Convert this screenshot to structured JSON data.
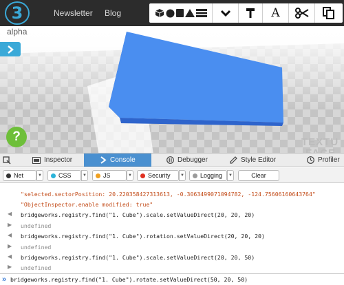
{
  "app": {
    "logo": "3",
    "subtitle": "alpha",
    "nav": [
      "Newsletter",
      "Blog"
    ]
  },
  "toolbar": {
    "shapes_icons": [
      "cube-icon",
      "sphere-icon",
      "cylinder-icon",
      "cone-icon",
      "stack-icon"
    ],
    "tools": [
      "dropdown-icon",
      "hammer-icon",
      "font-icon",
      "scissors-icon",
      "copy-icon"
    ],
    "font_letter": "A"
  },
  "viewport": {
    "help_label": "?",
    "watermark": [
      "TEXTU",
      "FACE"
    ],
    "object_color": "#4a8ef0"
  },
  "devtools": {
    "tabs": [
      {
        "icon": "inspect-icon",
        "label": ""
      },
      {
        "icon": "inspector-icon",
        "label": "Inspector"
      },
      {
        "icon": "console-icon",
        "label": "Console"
      },
      {
        "icon": "debugger-icon",
        "label": "Debugger"
      },
      {
        "icon": "style-editor-icon",
        "label": "Style Editor"
      },
      {
        "icon": "profiler-icon",
        "label": "Profiler"
      }
    ],
    "active_tab": "Console",
    "filters": [
      {
        "label": "Net",
        "color": "#333333"
      },
      {
        "label": "CSS",
        "color": "#2bb3d9"
      },
      {
        "label": "JS",
        "color": "#f0a020"
      },
      {
        "label": "Security",
        "color": "#e03020"
      },
      {
        "label": "Logging",
        "color": "#9a9a9a"
      }
    ],
    "clear_label": "Clear"
  },
  "console": {
    "lines": [
      {
        "type": "str",
        "text": "\"selected.sectorPosition: 20.220358427313613, -0.3063499071094782, -124.75606160643764\""
      },
      {
        "type": "str",
        "text": "\"ObjectInspector.enable modified: true\""
      },
      {
        "type": "cmd",
        "text": "bridgeworks.registry.find(\"1. Cube\").scale.setValueDirect(20, 20, 20)"
      },
      {
        "type": "undef",
        "text": "undefined"
      },
      {
        "type": "cmd",
        "text": "bridgeworks.registry.find(\"1. Cube\").rotation.setValueDirect(20, 20, 20)"
      },
      {
        "type": "undef",
        "text": "undefined"
      },
      {
        "type": "cmd",
        "text": "bridgeworks.registry.find(\"1. Cube\").scale.setValueDirect(20, 20, 50)"
      },
      {
        "type": "undef",
        "text": "undefined"
      }
    ],
    "input_value": "bridgeworks.registry.find(\"1. Cube\").rotate.setValueDirect(50, 20, 50)",
    "prompt": "»"
  }
}
